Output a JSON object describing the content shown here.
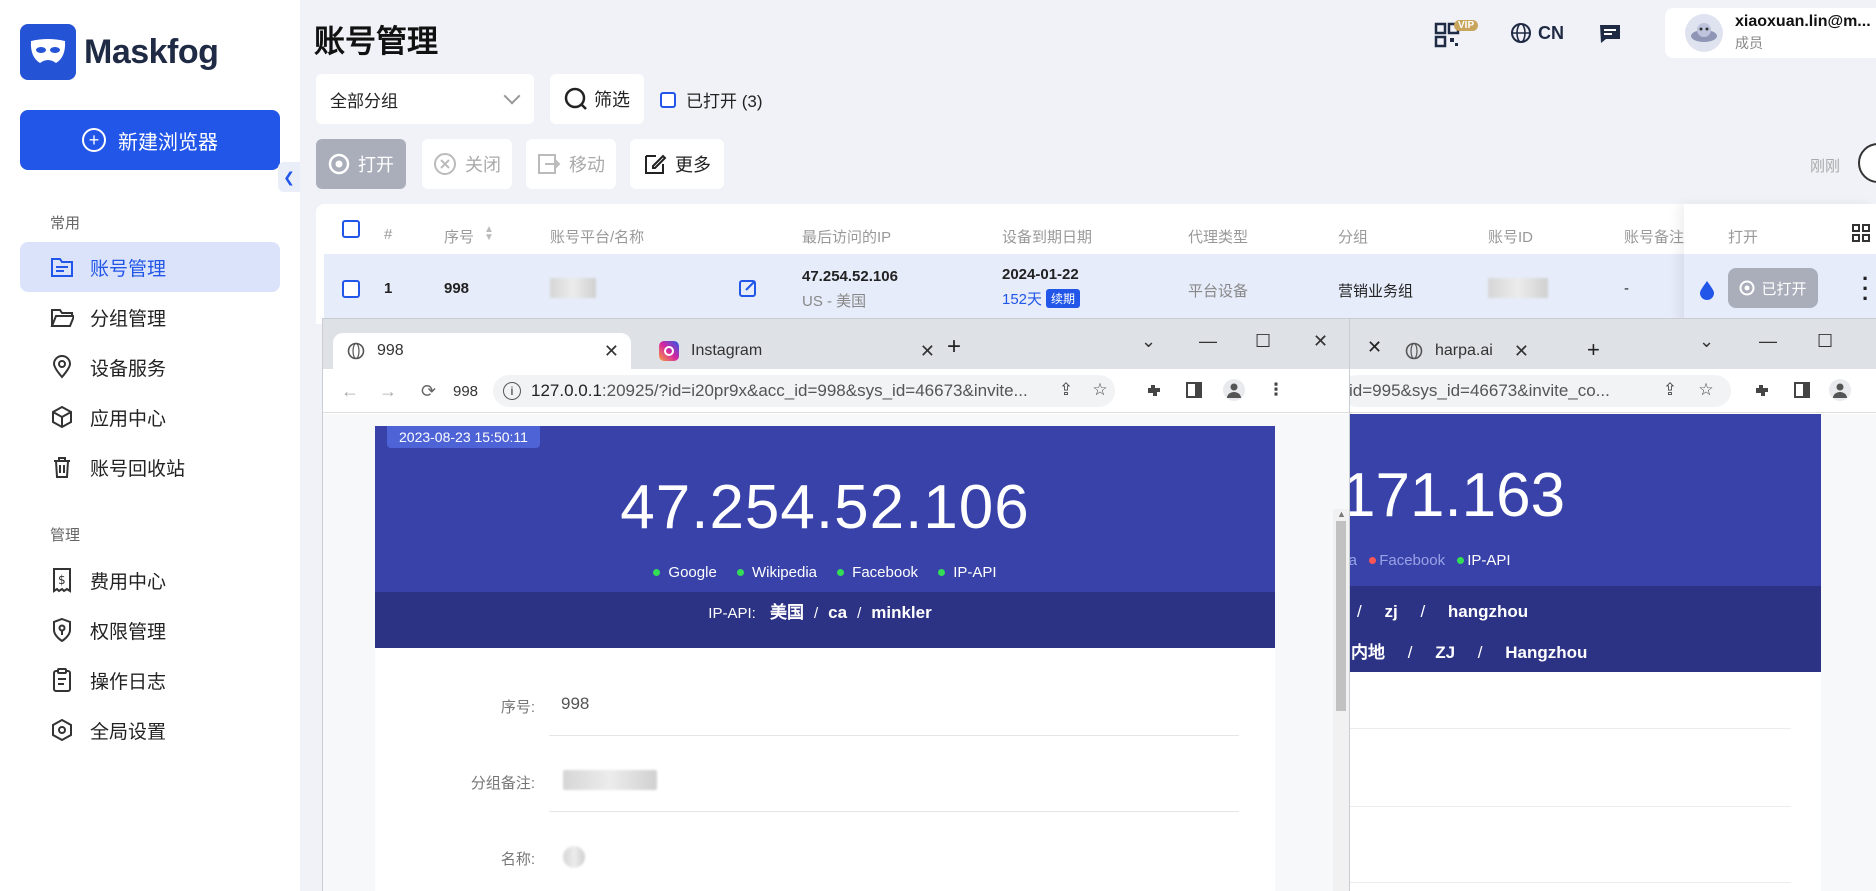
{
  "app": {
    "name": "Maskfog",
    "new_browser_label": "新建浏览器"
  },
  "sidebar": {
    "section_common": "常用",
    "section_manage": "管理",
    "common_items": [
      {
        "label": "账号管理",
        "icon": "account-folder-icon",
        "active": true
      },
      {
        "label": "分组管理",
        "icon": "folder-open-icon"
      },
      {
        "label": "设备服务",
        "icon": "location-pin-icon"
      },
      {
        "label": "应用中心",
        "icon": "cube-icon"
      },
      {
        "label": "账号回收站",
        "icon": "trash-icon"
      }
    ],
    "manage_items": [
      {
        "label": "费用中心",
        "icon": "dollar-receipt-icon"
      },
      {
        "label": "权限管理",
        "icon": "shield-key-icon"
      },
      {
        "label": "操作日志",
        "icon": "clipboard-icon"
      },
      {
        "label": "全局设置",
        "icon": "settings-hex-icon"
      }
    ]
  },
  "header": {
    "title": "账号管理",
    "vip_badge": "VIP",
    "language": "CN",
    "user_email": "xiaoxuan.lin@m...",
    "user_role": "成员"
  },
  "filters": {
    "group_select": "全部分组",
    "filter_label": "筛选",
    "opened_label": "已打开 (3)"
  },
  "toolbar": {
    "open": "打开",
    "close": "关闭",
    "move": "移动",
    "more": "更多",
    "recent": "刚刚"
  },
  "table": {
    "headers": [
      "#",
      "序号",
      "账号平台/名称",
      "最后访问的IP",
      "设备到期日期",
      "代理类型",
      "分组",
      "账号ID",
      "账号备注",
      "打开"
    ],
    "row": {
      "index": "1",
      "serial": "998",
      "ip": "47.254.52.106",
      "ip_region": "US - 美国",
      "expiry_date": "2024-01-22",
      "days_left": "152天",
      "renew": "续期",
      "proxy_type": "平台设备",
      "group": "营销业务组",
      "note": "-",
      "open_state": "已打开"
    }
  },
  "browser_front": {
    "tabs": [
      {
        "title": "998",
        "active": true
      },
      {
        "title": "Instagram",
        "active": false
      }
    ],
    "profile_label": "998",
    "url_host": "127.0.0.1",
    "url_rest": ":20925/?id=i20pr9x&acc_id=998&sys_id=46673&invite...",
    "timestamp": "2023-08-23 15:50:11",
    "ip": "47.254.52.106",
    "checks": [
      "Google",
      "Wikipedia",
      "Facebook",
      "IP-API"
    ],
    "ipapi_label": "IP-API:",
    "ipapi_country": "美国",
    "ipapi_region": "ca",
    "ipapi_city": "minkler",
    "info": [
      {
        "label": "序号:",
        "value": "998"
      },
      {
        "label": "分组备注:",
        "value": ""
      },
      {
        "label": "名称:",
        "value": ""
      }
    ]
  },
  "browser_back": {
    "tabs": [
      {
        "title": "harpa.ai"
      }
    ],
    "url_rest": "id=995&sys_id=46673&invite_co...",
    "ip_partial": "171.163",
    "checks": [
      {
        "name": "dia",
        "ok": true
      },
      {
        "name": "Facebook",
        "ok": false
      },
      {
        "name": "IP-API",
        "ok": true
      }
    ],
    "line1": [
      "zj",
      "hangzhou"
    ],
    "line2": [
      "内地",
      "ZJ",
      "Hangzhou"
    ]
  },
  "colors": {
    "accent": "#2156e8",
    "hero": "#3842a9",
    "hero_dark": "#2c3284"
  }
}
